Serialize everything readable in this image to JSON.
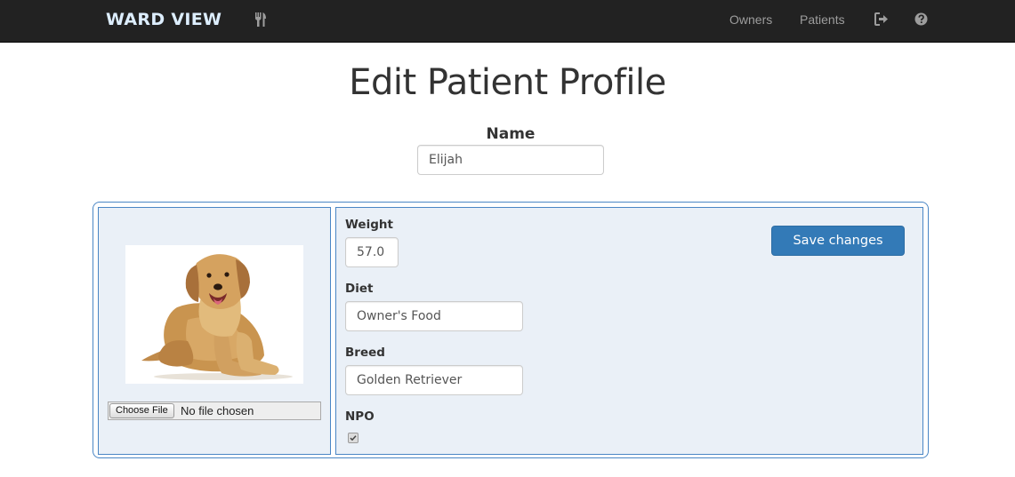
{
  "navbar": {
    "brand": "WARD VIEW",
    "fork_icon": "fork-knife-icon",
    "links": {
      "owners": "Owners",
      "patients": "Patients"
    },
    "signout_icon": "sign-out-icon",
    "help_icon": "question-circle-icon"
  },
  "page": {
    "title": "Edit Patient Profile"
  },
  "name": {
    "label": "Name",
    "value": "Elijah"
  },
  "photo": {
    "image": "golden-retriever-photo",
    "choose_file_label": "Choose File",
    "no_file_text": "No file chosen"
  },
  "fields": {
    "weight": {
      "label": "Weight",
      "value": "57.0"
    },
    "diet": {
      "label": "Diet",
      "value": "Owner's Food"
    },
    "breed": {
      "label": "Breed",
      "value": "Golden Retriever"
    },
    "npo": {
      "label": "NPO",
      "checked": true
    }
  },
  "actions": {
    "save_label": "Save changes"
  },
  "colors": {
    "navbar_bg": "#222222",
    "brand": "#ddeeff",
    "panel_border": "#4a86c5",
    "panel_bg": "#eaf0f7",
    "primary_button": "#337ab7"
  }
}
